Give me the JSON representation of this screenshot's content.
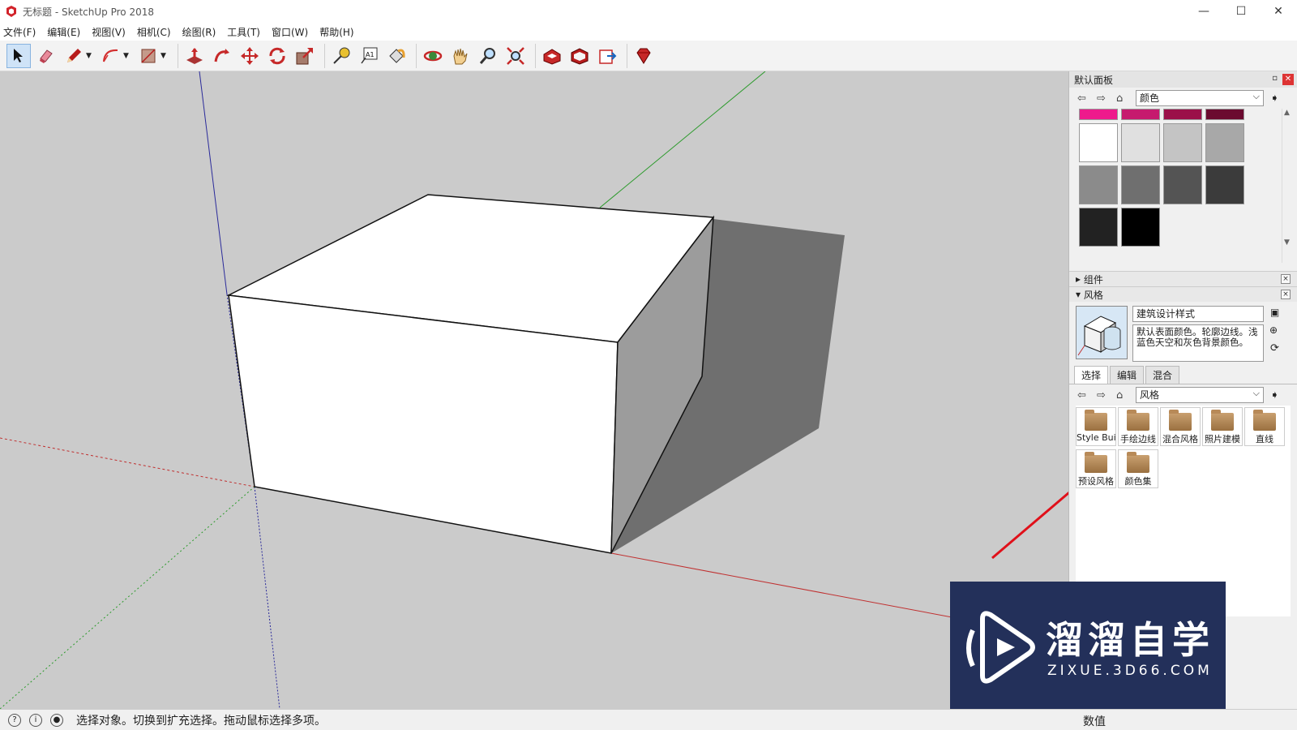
{
  "window": {
    "title": "无标题 - SketchUp Pro 2018",
    "minimize": "—",
    "maximize": "☐",
    "close": "✕"
  },
  "menu": [
    "文件(F)",
    "编辑(E)",
    "视图(V)",
    "相机(C)",
    "绘图(R)",
    "工具(T)",
    "窗口(W)",
    "帮助(H)"
  ],
  "toolbar": {
    "icons": [
      "select-icon",
      "eraser-icon",
      "pencil-icon",
      "arc-icon",
      "rectangle-icon",
      "push-pull-icon",
      "follow-me-icon",
      "move-icon",
      "rotate-icon",
      "scale-icon",
      "tape-measure-icon",
      "text-icon",
      "paint-bucket-icon",
      "orbit-icon",
      "pan-icon",
      "zoom-icon",
      "zoom-extents-icon",
      "3d-warehouse-icon",
      "extension-warehouse-icon",
      "layout-icon",
      "ruby-icon"
    ]
  },
  "panel": {
    "title": "默认面板",
    "pin": "▫",
    "close": "✕",
    "materials": {
      "selected": "颜色",
      "swatch_colors": [
        "#ee1a8c",
        "#c61a6e",
        "#9b1049",
        "#6b0a2f",
        "#ffffff",
        "#e0e0e0",
        "#c4c4c4",
        "#a8a8a8",
        "#8b8b8b",
        "#6f6f6f",
        "#545454",
        "#3b3b3b",
        "#222222",
        "#000000"
      ]
    },
    "components_label": "组件",
    "styles_label": "风格",
    "style": {
      "name": "建筑设计样式",
      "description": "默认表面颜色。轮廓边线。浅蓝色天空和灰色背景颜色。"
    },
    "tabs": [
      "选择",
      "编辑",
      "混合"
    ],
    "styles_selected": "风格",
    "folders": [
      "Style Buil",
      "手绘边线",
      "混合风格",
      "照片建模",
      "直线",
      "预设风格",
      "颜色集"
    ],
    "section_x": "×"
  },
  "status": {
    "message": "选择对象。切换到扩充选择。拖动鼠标选择多项。",
    "value_label": "数值"
  },
  "watermark": {
    "main": "溜溜自学",
    "sub": "ZIXUE.3D66.COM"
  },
  "colors": {
    "viewport_bg": "#cbcbcb",
    "annotation_arrow": "#e0101a",
    "watermark_bg": "#23305a"
  }
}
